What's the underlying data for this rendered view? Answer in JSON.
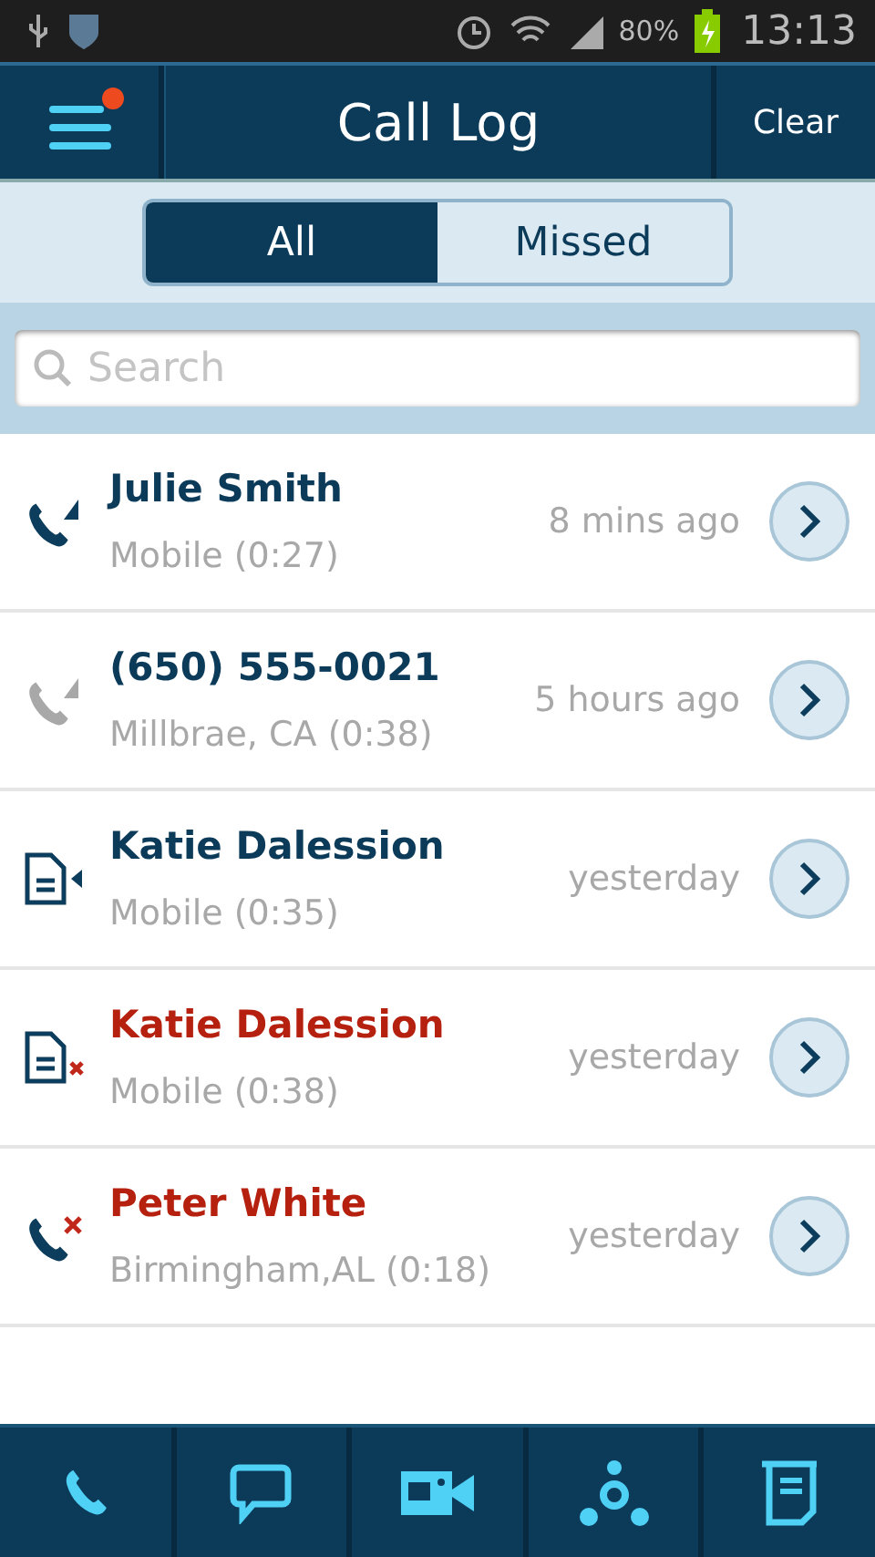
{
  "status_bar": {
    "battery": "80%",
    "time": "13:13"
  },
  "header": {
    "title": "Call Log",
    "menu_badge": true,
    "action": "Clear"
  },
  "filters": [
    {
      "label": "All",
      "selected": true
    },
    {
      "label": "Missed",
      "selected": false
    }
  ],
  "search": {
    "placeholder": "Search"
  },
  "calls": [
    {
      "kind": "call",
      "missed": false,
      "faded": false,
      "name": "Julie Smith",
      "detail": "Mobile (0:27)",
      "time": "8 mins ago"
    },
    {
      "kind": "call",
      "missed": false,
      "faded": true,
      "name": "(650) 555-0021",
      "detail": "Millbrae, CA (0:38)",
      "time": "5 hours ago"
    },
    {
      "kind": "voicemail",
      "missed": false,
      "faded": false,
      "name": "Katie Dalession",
      "detail": "Mobile (0:35)",
      "time": "yesterday"
    },
    {
      "kind": "voicemail",
      "missed": true,
      "faded": false,
      "name": "Katie Dalession",
      "detail": "Mobile (0:38)",
      "time": "yesterday"
    },
    {
      "kind": "call",
      "missed": true,
      "faded": false,
      "name": "Peter White",
      "detail": "Birmingham,AL (0:18)",
      "time": "yesterday"
    }
  ],
  "tab_bar": [
    {
      "kind": "phone"
    },
    {
      "kind": "chat"
    },
    {
      "kind": "video"
    },
    {
      "kind": "contacts"
    },
    {
      "kind": "notes"
    }
  ]
}
